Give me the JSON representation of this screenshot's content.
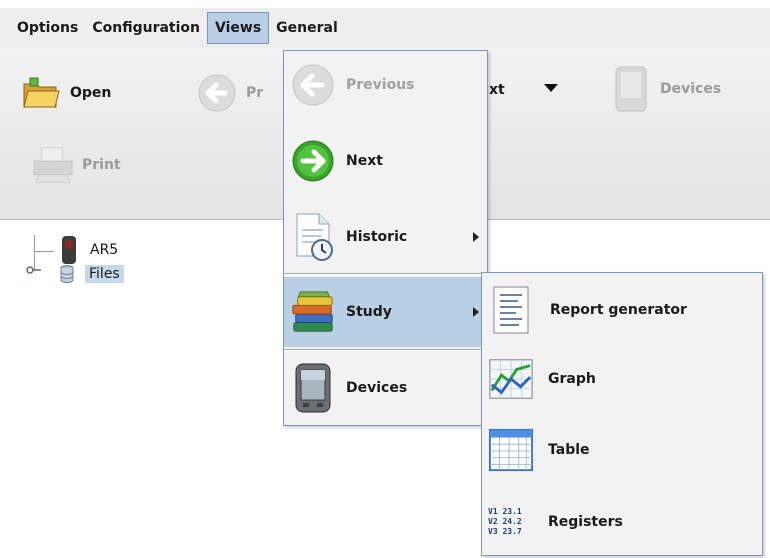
{
  "menubar": {
    "items": [
      {
        "label": "Options"
      },
      {
        "label": "Configuration"
      },
      {
        "label": "Views"
      },
      {
        "label": "General"
      }
    ]
  },
  "toolbar": {
    "open": "Open",
    "previous_partial": "Pr",
    "next_partial": "xt",
    "devices": "Devices",
    "print": "Print"
  },
  "tree": {
    "node1": "AR5",
    "node2": "Files"
  },
  "views_menu": {
    "items": [
      {
        "label": "Previous",
        "icon": "arrow-left-icon",
        "enabled": false
      },
      {
        "label": "Next",
        "icon": "arrow-right-icon",
        "enabled": true
      },
      {
        "label": "Historic",
        "icon": "historic-document-icon",
        "enabled": true,
        "submenu": true
      },
      {
        "label": "Study",
        "icon": "books-icon",
        "enabled": true,
        "submenu": true,
        "highlighted": true
      },
      {
        "label": "Devices",
        "icon": "pda-device-icon",
        "enabled": true
      }
    ]
  },
  "study_submenu": {
    "items": [
      {
        "label": "Report generator",
        "icon": "report-icon"
      },
      {
        "label": "Graph",
        "icon": "graph-icon"
      },
      {
        "label": "Table",
        "icon": "table-icon"
      },
      {
        "label": "Registers",
        "icon": "registers-icon"
      }
    ],
    "registers_icon_text": [
      "V1 23.1",
      "V2 24.2",
      "V3 23.7"
    ]
  },
  "colors": {
    "menu_highlight": "#b8cfe5",
    "menu_border": "#7a96b8",
    "next_green": "#3aa32b"
  }
}
